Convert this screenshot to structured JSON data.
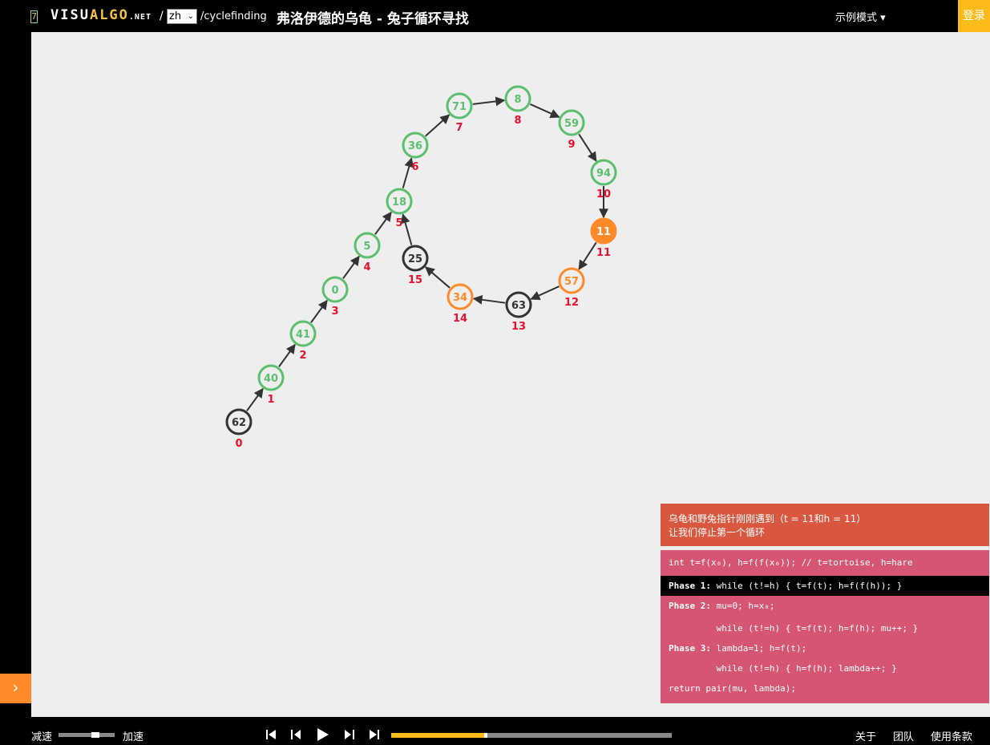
{
  "header": {
    "badge": "7",
    "logo_white1": "VISU",
    "logo_yellow": "ALGO",
    "logo_net": ".NET",
    "slash": "/",
    "lang": "zh",
    "path": "/cyclefinding",
    "title": "弗洛伊德的乌龟 - 兔子循环寻找",
    "mode": "示例模式 ▾",
    "login": "登录"
  },
  "colors": {
    "green": "#5cbf6e",
    "black": "#333333",
    "orange": "#ff8a27",
    "index": "#e8112d",
    "status_bg": "#d9573e",
    "code_bg": "#d55572",
    "yellow": "#fcbb1b"
  },
  "graph": {
    "nodes": [
      {
        "label": "62",
        "index": "0",
        "state": "black"
      },
      {
        "label": "40",
        "index": "1",
        "state": "green"
      },
      {
        "label": "41",
        "index": "2",
        "state": "green"
      },
      {
        "label": "0",
        "index": "3",
        "state": "green"
      },
      {
        "label": "5",
        "index": "4",
        "state": "green"
      },
      {
        "label": "18",
        "index": "5",
        "state": "green"
      },
      {
        "label": "36",
        "index": "6",
        "state": "green"
      },
      {
        "label": "71",
        "index": "7",
        "state": "green"
      },
      {
        "label": "8",
        "index": "8",
        "state": "green"
      },
      {
        "label": "59",
        "index": "9",
        "state": "green"
      },
      {
        "label": "94",
        "index": "10",
        "state": "green"
      },
      {
        "label": "11",
        "index": "11",
        "state": "orange-filled"
      },
      {
        "label": "57",
        "index": "12",
        "state": "orange"
      },
      {
        "label": "63",
        "index": "13",
        "state": "black"
      },
      {
        "label": "34",
        "index": "14",
        "state": "orange"
      },
      {
        "label": "25",
        "index": "15",
        "state": "black"
      }
    ],
    "edges": [
      [
        0,
        1
      ],
      [
        1,
        2
      ],
      [
        2,
        3
      ],
      [
        3,
        4
      ],
      [
        4,
        5
      ],
      [
        5,
        6
      ],
      [
        6,
        7
      ],
      [
        7,
        8
      ],
      [
        8,
        9
      ],
      [
        9,
        10
      ],
      [
        10,
        11
      ],
      [
        11,
        12
      ],
      [
        12,
        13
      ],
      [
        13,
        14
      ],
      [
        14,
        15
      ],
      [
        15,
        5
      ]
    ]
  },
  "status": {
    "line1": "乌龟和野兔指针刚刚遇到（t = 11和h = 11）",
    "line2": "让我们停止第一个循环"
  },
  "pseudocode": [
    {
      "bold": "",
      "text": "int t=f(x₀), h=f(f(x₀)); // t=tortoise, h=hare"
    },
    {
      "bold": "Phase 1: ",
      "text": "while (t!=h) { t=f(t); h=f(f(h)); }"
    },
    {
      "bold": "Phase 2: ",
      "text": "mu=0; h=x₀;"
    },
    {
      "bold": "",
      "text": "         while (t!=h) { t=f(t); h=f(h); mu++; }"
    },
    {
      "bold": "Phase 3: ",
      "text": "lambda=1; h=f(t);"
    },
    {
      "bold": "",
      "text": "         while (t!=h) { h=f(h); lambda++; }"
    },
    {
      "bold": "",
      "text": "return pair(mu, lambda);"
    }
  ],
  "active_line": 1,
  "footer": {
    "slower": "减速",
    "faster": "加速",
    "speed_level": 0.65,
    "progress": 0.33,
    "about": "关于",
    "team": "团队",
    "terms": "使用条款"
  }
}
